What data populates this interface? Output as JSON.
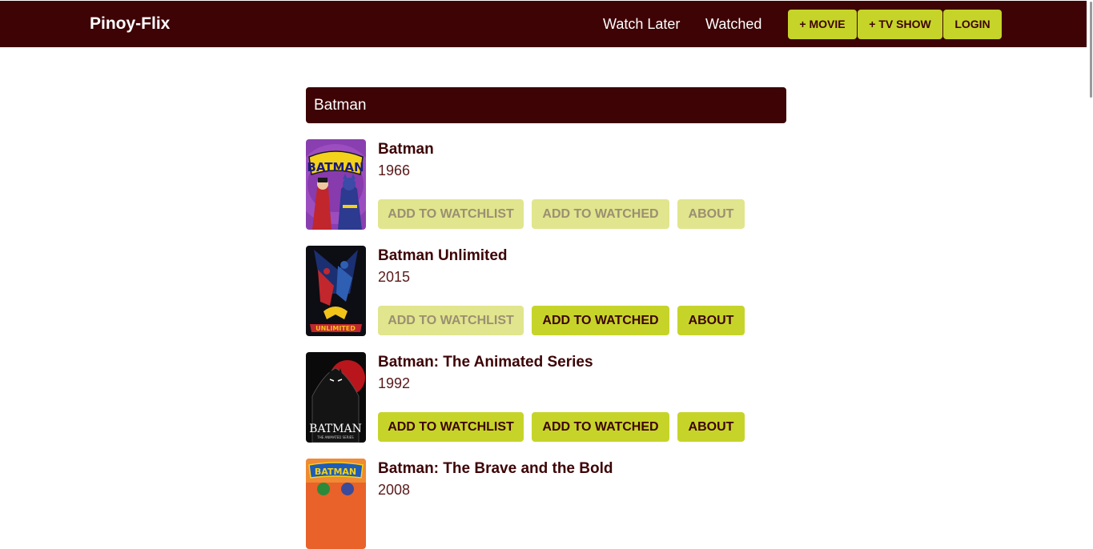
{
  "navbar": {
    "brand": "Pinoy-Flix",
    "links": [
      "Watch Later",
      "Watched"
    ],
    "buttons": [
      "+ MOVIE",
      "+ TV SHOW",
      "LOGIN"
    ]
  },
  "search": {
    "value": "Batman"
  },
  "results": [
    {
      "title": "Batman",
      "year": "1966",
      "poster_text": "BATMAN",
      "watchlist_label": "ADD TO WATCHLIST",
      "watchlist_enabled": false,
      "watched_label": "ADD TO WATCHED",
      "watched_enabled": false,
      "about_label": "ABOUT",
      "about_enabled": false
    },
    {
      "title": "Batman Unlimited",
      "year": "2015",
      "poster_text": "UNLIMITED",
      "watchlist_label": "ADD TO WATCHLIST",
      "watchlist_enabled": false,
      "watched_label": "ADD TO WATCHED",
      "watched_enabled": true,
      "about_label": "ABOUT",
      "about_enabled": true
    },
    {
      "title": "Batman: The Animated Series",
      "year": "1992",
      "poster_text": "BATMAN",
      "poster_subtext": "THE ANIMATED SERIES",
      "watchlist_label": "ADD TO WATCHLIST",
      "watchlist_enabled": true,
      "watched_label": "ADD TO WATCHED",
      "watched_enabled": true,
      "about_label": "ABOUT",
      "about_enabled": true
    },
    {
      "title": "Batman: The Brave and the Bold",
      "year": "2008",
      "poster_text": "BATMAN"
    }
  ],
  "colors": {
    "primary": "#3d0305",
    "accent": "#c6d42a",
    "accent_disabled": "#e1e58d"
  }
}
